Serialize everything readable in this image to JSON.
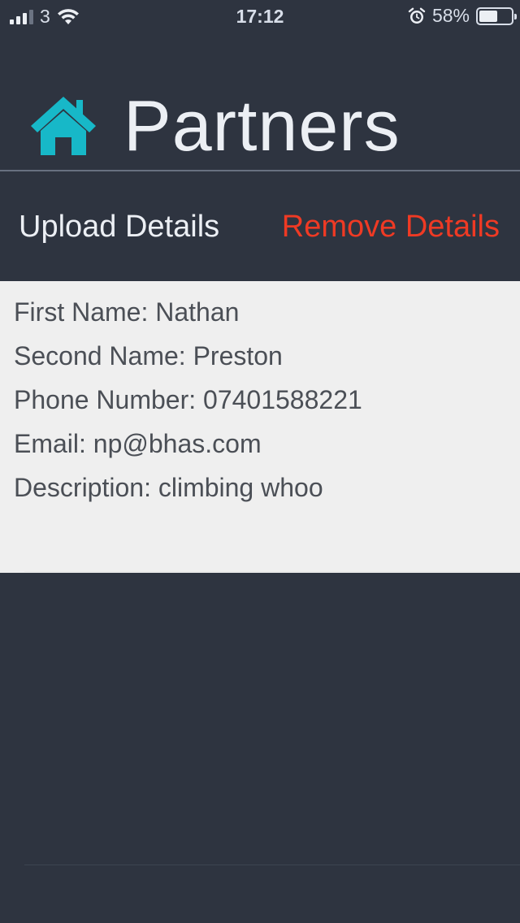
{
  "status_bar": {
    "carrier": "3",
    "time": "17:12",
    "battery_percent": "58%",
    "battery_level": 0.58,
    "signal_bars": 3,
    "signal_total": 4,
    "icons": [
      "signal-icon",
      "wifi-icon",
      "alarm-icon",
      "battery-icon"
    ]
  },
  "header": {
    "title": "Partners",
    "icon": "home-icon",
    "icon_color": "#17b8c8"
  },
  "actions": {
    "upload_label": "Upload Details",
    "remove_label": "Remove Details",
    "remove_color": "#ef3a24"
  },
  "details": {
    "first_name": "First Name: Nathan",
    "second_name": "Second Name: Preston",
    "phone": "Phone Number: 07401588221",
    "email": "Email: np@bhas.com",
    "description": "Description: climbing whoo"
  },
  "colors": {
    "background": "#2e3440",
    "card_background": "#efefef",
    "text_light": "#eceff4",
    "text_dark": "#4b4f56"
  }
}
